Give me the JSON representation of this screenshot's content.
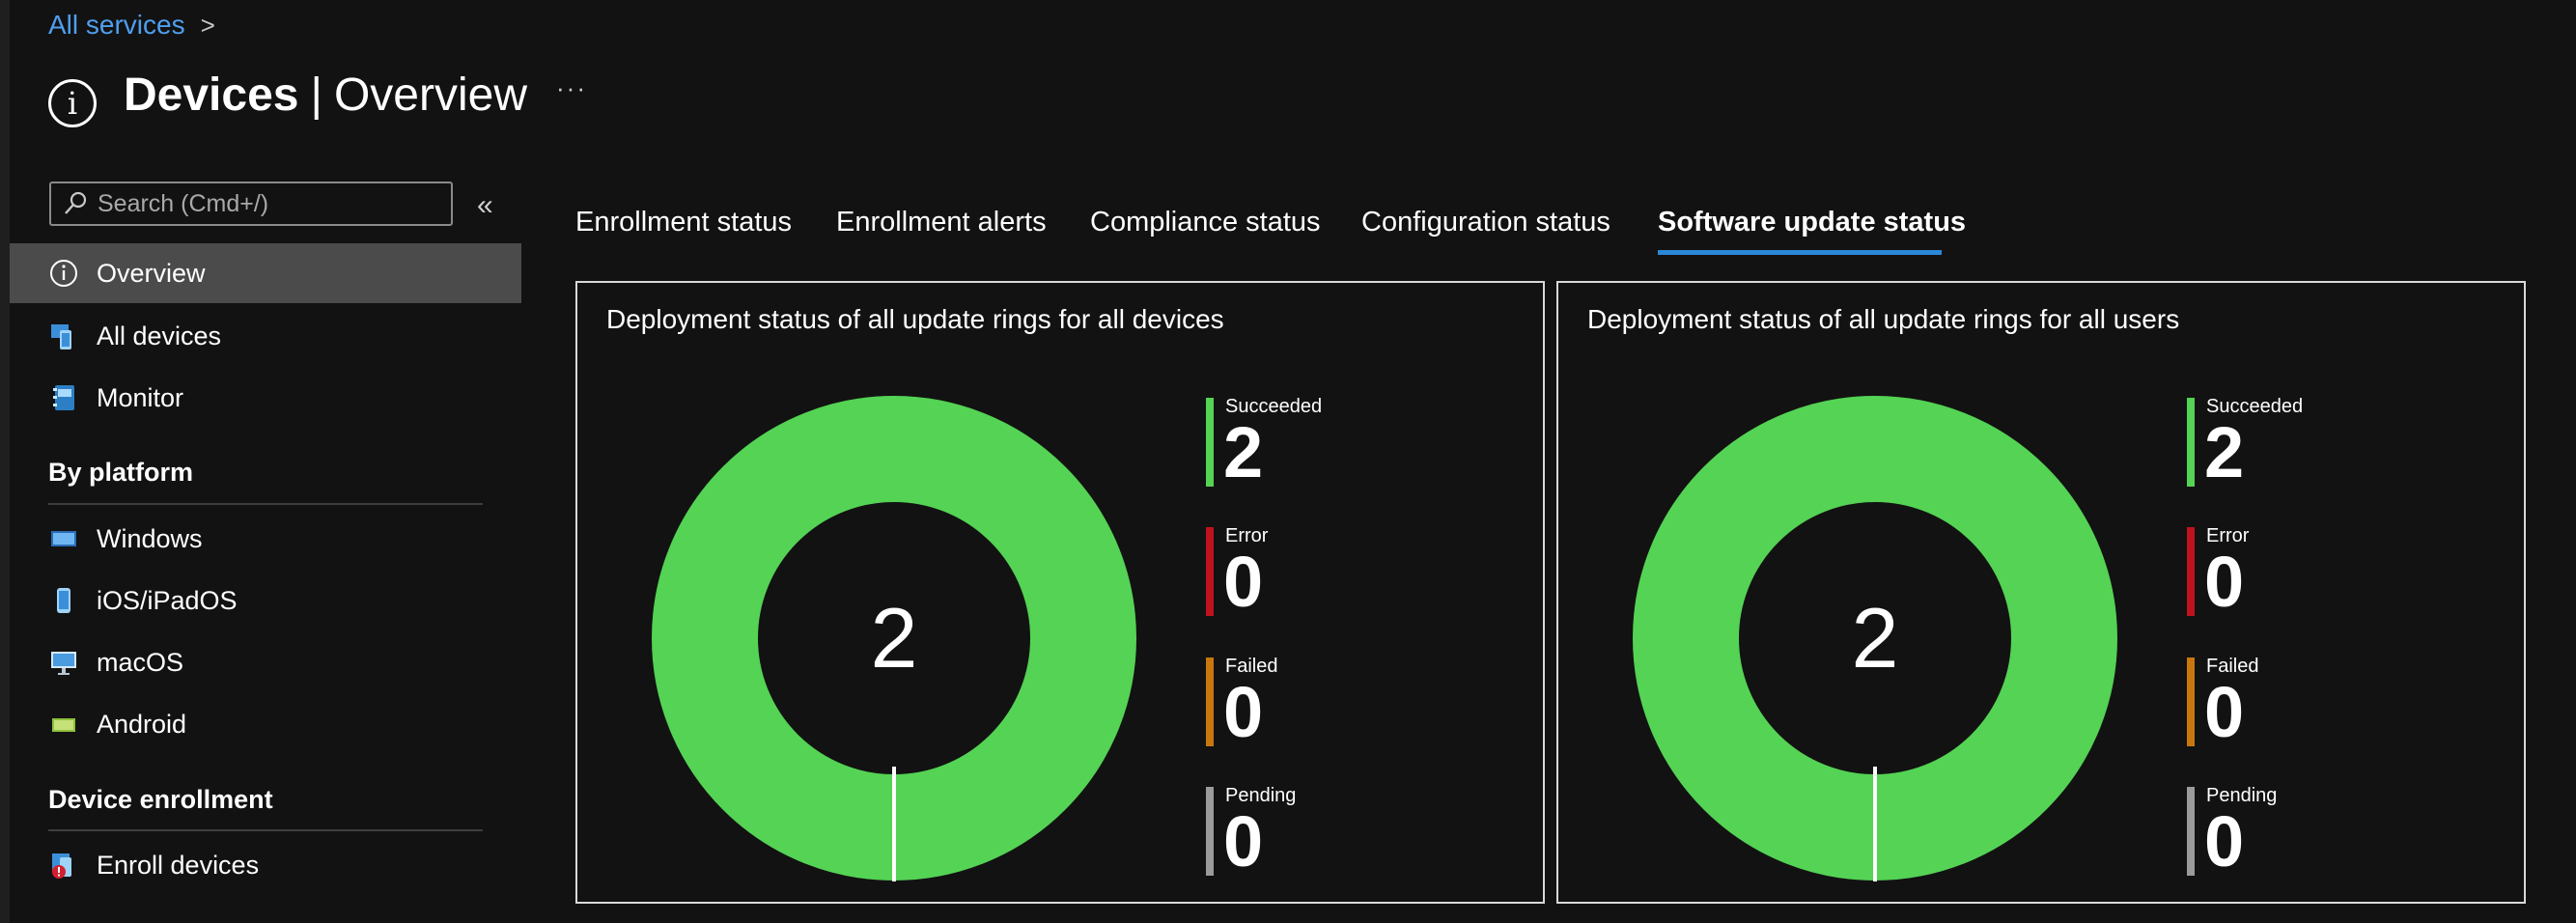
{
  "breadcrumb": {
    "link": "All services",
    "chevron": ">"
  },
  "header": {
    "title_bold": "Devices",
    "separator": "|",
    "title_rest": "Overview",
    "more": "···"
  },
  "search": {
    "placeholder": "Search (Cmd+/)"
  },
  "sidebar": {
    "collapse": "«",
    "items": [
      {
        "label": "Overview",
        "icon": "info-icon",
        "active": true
      },
      {
        "label": "All devices",
        "icon": "devices-icon"
      },
      {
        "label": "Monitor",
        "icon": "monitor-book-icon"
      }
    ],
    "sections": [
      {
        "heading": "By platform",
        "items": [
          {
            "label": "Windows",
            "icon": "windows-laptop-icon"
          },
          {
            "label": "iOS/iPadOS",
            "icon": "phone-icon"
          },
          {
            "label": "macOS",
            "icon": "mac-desktop-icon"
          },
          {
            "label": "Android",
            "icon": "android-device-icon"
          }
        ]
      },
      {
        "heading": "Device enrollment",
        "items": [
          {
            "label": "Enroll devices",
            "icon": "enroll-devices-icon"
          }
        ]
      }
    ]
  },
  "tabs": [
    {
      "label": "Enrollment status"
    },
    {
      "label": "Enrollment alerts"
    },
    {
      "label": "Compliance status"
    },
    {
      "label": "Configuration status"
    },
    {
      "label": "Software update status",
      "active": true
    }
  ],
  "colors": {
    "succeeded": "#54d354",
    "error": "#c0111f",
    "failed": "#c8770e",
    "pending": "#9b9b9b",
    "accent": "#2b88d8",
    "link": "#4f9ff0"
  },
  "cards": [
    {
      "title": "Deployment status of all update rings for all devices",
      "center": "2",
      "legend": [
        {
          "name": "Succeeded",
          "value": "2"
        },
        {
          "name": "Error",
          "value": "0"
        },
        {
          "name": "Failed",
          "value": "0"
        },
        {
          "name": "Pending",
          "value": "0"
        }
      ]
    },
    {
      "title": "Deployment status of all update rings for all users",
      "center": "2",
      "legend": [
        {
          "name": "Succeeded",
          "value": "2"
        },
        {
          "name": "Error",
          "value": "0"
        },
        {
          "name": "Failed",
          "value": "0"
        },
        {
          "name": "Pending",
          "value": "0"
        }
      ]
    }
  ]
}
